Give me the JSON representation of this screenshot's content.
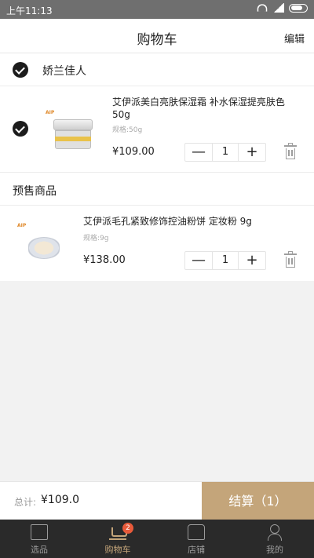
{
  "status_bar": {
    "time": "上午11:13"
  },
  "header": {
    "title": "购物车",
    "edit_label": "编辑"
  },
  "store": {
    "name": "娇兰佳人"
  },
  "items": [
    {
      "name": "艾伊派美白亮肤保湿霜 补水保湿提亮肤色 50g",
      "spec": "规格:50g",
      "price": "¥109.00",
      "quantity": "1",
      "selected": true
    },
    {
      "name": "艾伊派毛孔紧致修饰控油粉饼 定妆粉 9g",
      "spec": "规格:9g",
      "price": "¥138.00",
      "quantity": "1",
      "selected": false
    }
  ],
  "stepper": {
    "minus": "—",
    "plus": "+"
  },
  "presale": {
    "label": "预售商品"
  },
  "summary": {
    "total_label": "总计:",
    "total_value": "¥109.0",
    "checkout_label": "结算（1）"
  },
  "tabbar": {
    "tabs": [
      {
        "label": "选品",
        "icon": "box-icon"
      },
      {
        "label": "购物车",
        "icon": "cart-icon",
        "badge": "2",
        "active": true
      },
      {
        "label": "店铺",
        "icon": "store-icon"
      },
      {
        "label": "我的",
        "icon": "user-icon"
      }
    ]
  },
  "colors": {
    "accent": "#c4a57a",
    "badge": "#e85a3a",
    "tabbar_bg": "#2a2a2a"
  }
}
